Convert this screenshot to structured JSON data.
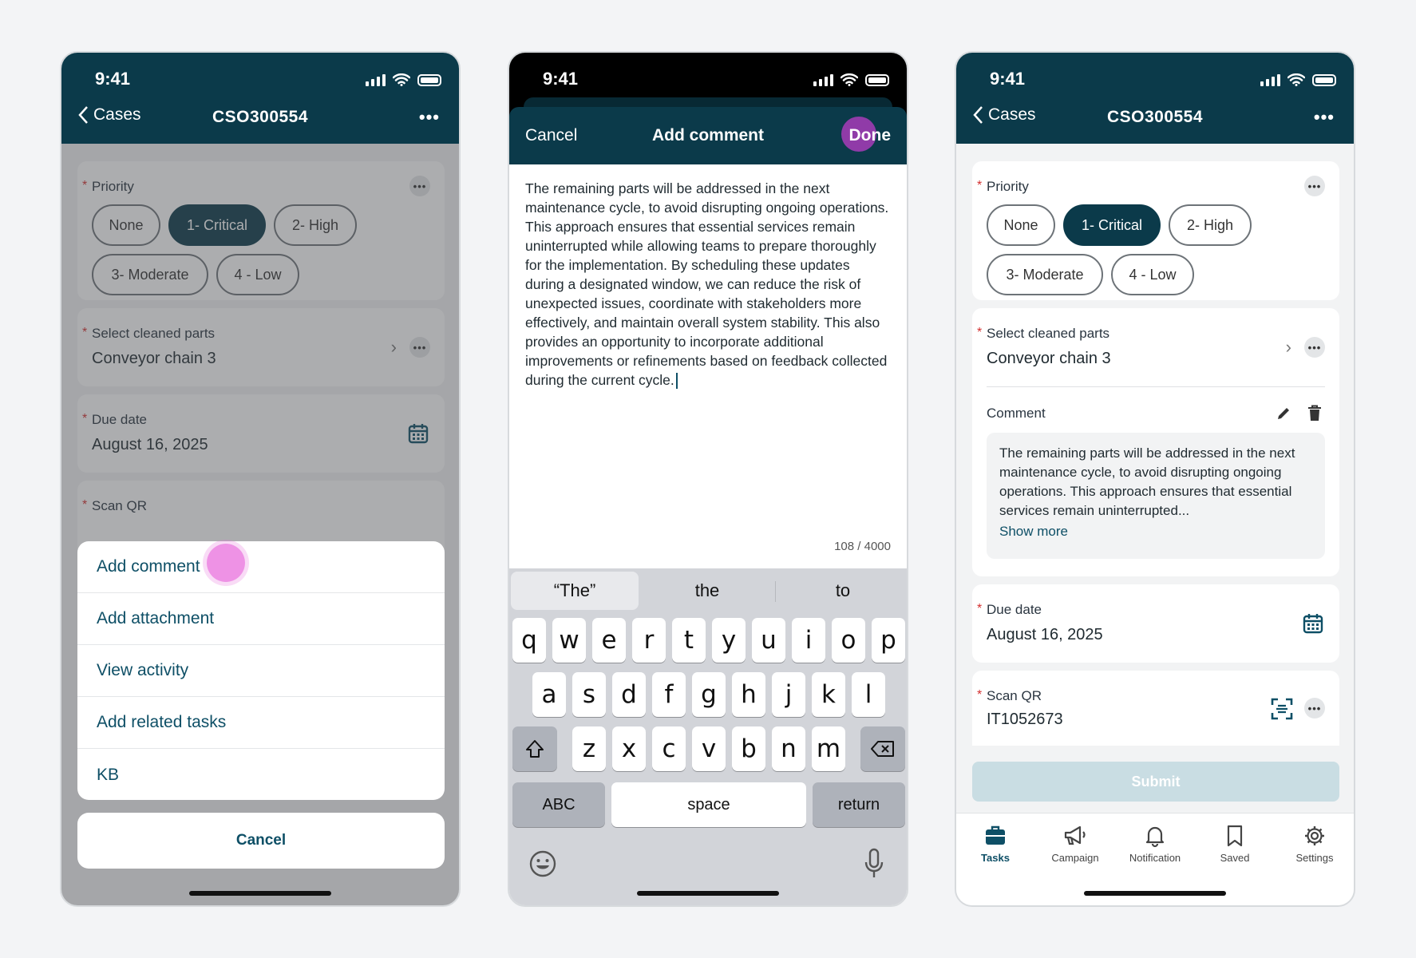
{
  "status_time": "9:41",
  "screen1": {
    "back_label": "Cases",
    "title": "CSO300554",
    "priority_label": "Priority",
    "priority_chips": [
      "None",
      "1- Critical",
      "2- High",
      "3- Moderate",
      "4 - Low"
    ],
    "selected_priority": "1- Critical",
    "parts_label": "Select cleaned parts",
    "parts_value": "Conveyor chain 3",
    "due_label": "Due date",
    "due_value": "August 16, 2025",
    "scan_label": "Scan QR",
    "menu_items": [
      "Add comment",
      "Add attachment",
      "View activity",
      "Add related tasks",
      "KB"
    ],
    "cancel_label": "Cancel"
  },
  "screen2": {
    "cancel_label": "Cancel",
    "title": "Add comment",
    "done_label": "Done",
    "comment_text": "The remaining parts will be addressed in the next maintenance cycle, to avoid disrupting ongoing operations. This approach ensures that essential services remain uninterrupted while allowing teams to prepare thoroughly for the implementation. By scheduling these updates during a designated window, we can reduce the risk of unexpected issues, coordinate with stakeholders more effectively, and maintain overall system stability. This also provides an opportunity to incorporate additional improvements or refinements based on feedback collected during the current cycle.",
    "char_count": "108 / 4000",
    "suggestions": [
      "“The”",
      "the",
      "to"
    ],
    "row1": [
      "q",
      "w",
      "e",
      "r",
      "t",
      "y",
      "u",
      "i",
      "o",
      "p"
    ],
    "row2": [
      "a",
      "s",
      "d",
      "f",
      "g",
      "h",
      "j",
      "k",
      "l"
    ],
    "row3": [
      "z",
      "x",
      "c",
      "v",
      "b",
      "n",
      "m"
    ],
    "abc_label": "ABC",
    "space_label": "space",
    "return_label": "return"
  },
  "screen3": {
    "back_label": "Cases",
    "title": "CSO300554",
    "priority_label": "Priority",
    "priority_chips": [
      "None",
      "1- Critical",
      "2- High",
      "3- Moderate",
      "4 - Low"
    ],
    "selected_priority": "1- Critical",
    "parts_label": "Select cleaned parts",
    "parts_value": "Conveyor chain 3",
    "comment_label": "Comment",
    "comment_preview": "The remaining parts will be addressed in the next maintenance cycle, to avoid disrupting ongoing operations. This approach ensures that essential services remain uninterrupted...",
    "show_more": "Show more",
    "due_label": "Due date",
    "due_value": "August 16, 2025",
    "scan_label": "Scan QR",
    "scan_value": "IT1052673",
    "submit_label": "Submit",
    "tabs": [
      "Tasks",
      "Campaign",
      "Notification",
      "Saved",
      "Settings"
    ],
    "active_tab": "Tasks"
  },
  "colors": {
    "header": "#0b3a4a",
    "accent_link": "#0e4f66",
    "required": "#d32f2f",
    "tap_indicator": "#e86edc",
    "submit_disabled": "#c9dde3"
  }
}
